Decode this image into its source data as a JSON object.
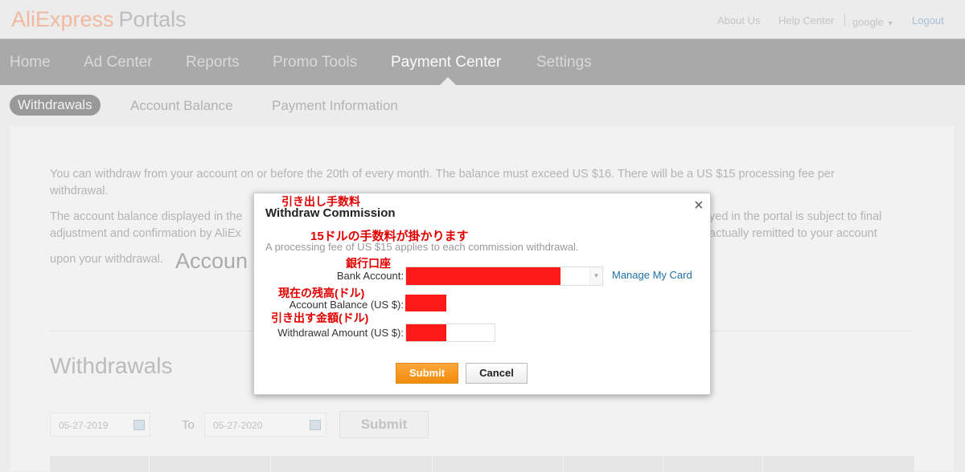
{
  "header": {
    "logo": "AliExpress Portals",
    "logo_part1": "AliExpress",
    "logo_part2": "Portals",
    "links": {
      "about": "About Us",
      "help": "Help Center",
      "user": "google",
      "logout": "Logout"
    }
  },
  "nav": {
    "items": [
      "Home",
      "Ad Center",
      "Reports",
      "Promo Tools",
      "Payment Center",
      "Settings"
    ],
    "active": "Payment Center"
  },
  "subnav": {
    "items": [
      "Withdrawals",
      "Account Balance",
      "Payment Information"
    ],
    "active": "Withdrawals"
  },
  "content": {
    "para1_line1": "You can withdraw from your account on or before the 20th of every month. The balance must exceed US $16. There will be a US $15 processing fee per",
    "para1_line2": "withdrawal.",
    "para2_line1_left": "The account balance displayed in the",
    "para2_line1_right": "yed in the portal is subject to final",
    "para2_line2_left": "adjustment and confirmation by AliEx",
    "para2_line2_right": "actually remitted to your account",
    "para2_line3": "upon your withdrawal.",
    "account_heading_fragment": "Accoun",
    "withdrawals_title": "Withdrawals",
    "date_from": "05-27-2019",
    "to_label": "To",
    "date_to": "05-27-2020",
    "submit": "Submit"
  },
  "modal": {
    "title": "Withdraw Commission",
    "close": "×",
    "fee_note": "A processing fee of US $15 applies to each commission withdrawal.",
    "bank_label": "Bank Account:",
    "manage_card": "Manage My Card",
    "balance_label": "Account Balance (US $):",
    "amount_label": "Withdrawal Amount (US $):",
    "submit": "Submit",
    "cancel": "Cancel",
    "annotations": {
      "title": "引き出し手数料",
      "fee": "15ドルの手数料が掛かります",
      "bank": "銀行口座",
      "balance": "現在の残高(ドル)",
      "amount": "引き出す金額(ドル)"
    },
    "redaction_color": "#ff1a1a",
    "submit_color": "#f7941d",
    "link_color": "#1f6fa8"
  }
}
